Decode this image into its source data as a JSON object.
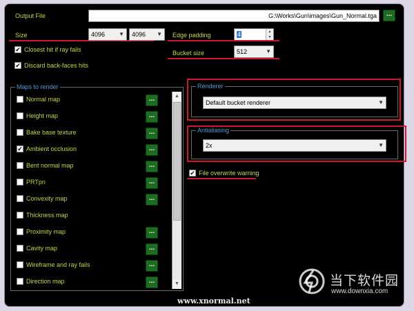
{
  "output_file": {
    "label": "Output File",
    "value": "G:\\Works\\Gun\\images\\Gun_Normal.tga",
    "browse": "..."
  },
  "size": {
    "label": "Size",
    "width": "4096",
    "height": "4096"
  },
  "edge_padding": {
    "label": "Edge padding",
    "value": "4"
  },
  "bucket_size": {
    "label": "Bucket size",
    "value": "512"
  },
  "options": {
    "closest_hit": "Closest hit if ray fails",
    "discard_backfaces": "Discard back-faces hits"
  },
  "maps": {
    "group_label": "Maps to render",
    "items": [
      {
        "label": "Normal map",
        "checked": "",
        "has_options": true
      },
      {
        "label": "Height map",
        "checked": "",
        "has_options": true
      },
      {
        "label": "Bake base texture",
        "checked": "",
        "has_options": true
      },
      {
        "label": "Ambient occlusion",
        "checked": "✔",
        "has_options": true
      },
      {
        "label": "Bent normal map",
        "checked": "",
        "has_options": true
      },
      {
        "label": "PRTpn",
        "checked": "",
        "has_options": true
      },
      {
        "label": "Convexity map",
        "checked": "",
        "has_options": true
      },
      {
        "label": "Thickness map",
        "checked": "",
        "has_options": false
      },
      {
        "label": "Proximity map",
        "checked": "",
        "has_options": true
      },
      {
        "label": "Cavity map",
        "checked": "",
        "has_options": true
      },
      {
        "label": "Wireframe and ray fails",
        "checked": "",
        "has_options": true
      },
      {
        "label": "Direction map",
        "checked": "",
        "has_options": true
      }
    ],
    "button_label": "..."
  },
  "renderer": {
    "group_label": "Renderer",
    "value": "Default bucket renderer"
  },
  "antialiasing": {
    "group_label": "Antialiasing",
    "value": "2x"
  },
  "file_overwrite": {
    "label": "File overwrite warning",
    "checked": "✔"
  },
  "footer": {
    "website": "www.xnormal.net"
  },
  "watermark": {
    "title": "当下软件园",
    "url": "www.downxia.com"
  },
  "colors": {
    "label_text": "#c8d44a",
    "group_label": "#4f9ad8",
    "highlight_red": "#d0182a",
    "button_green": "#1c6d22"
  }
}
